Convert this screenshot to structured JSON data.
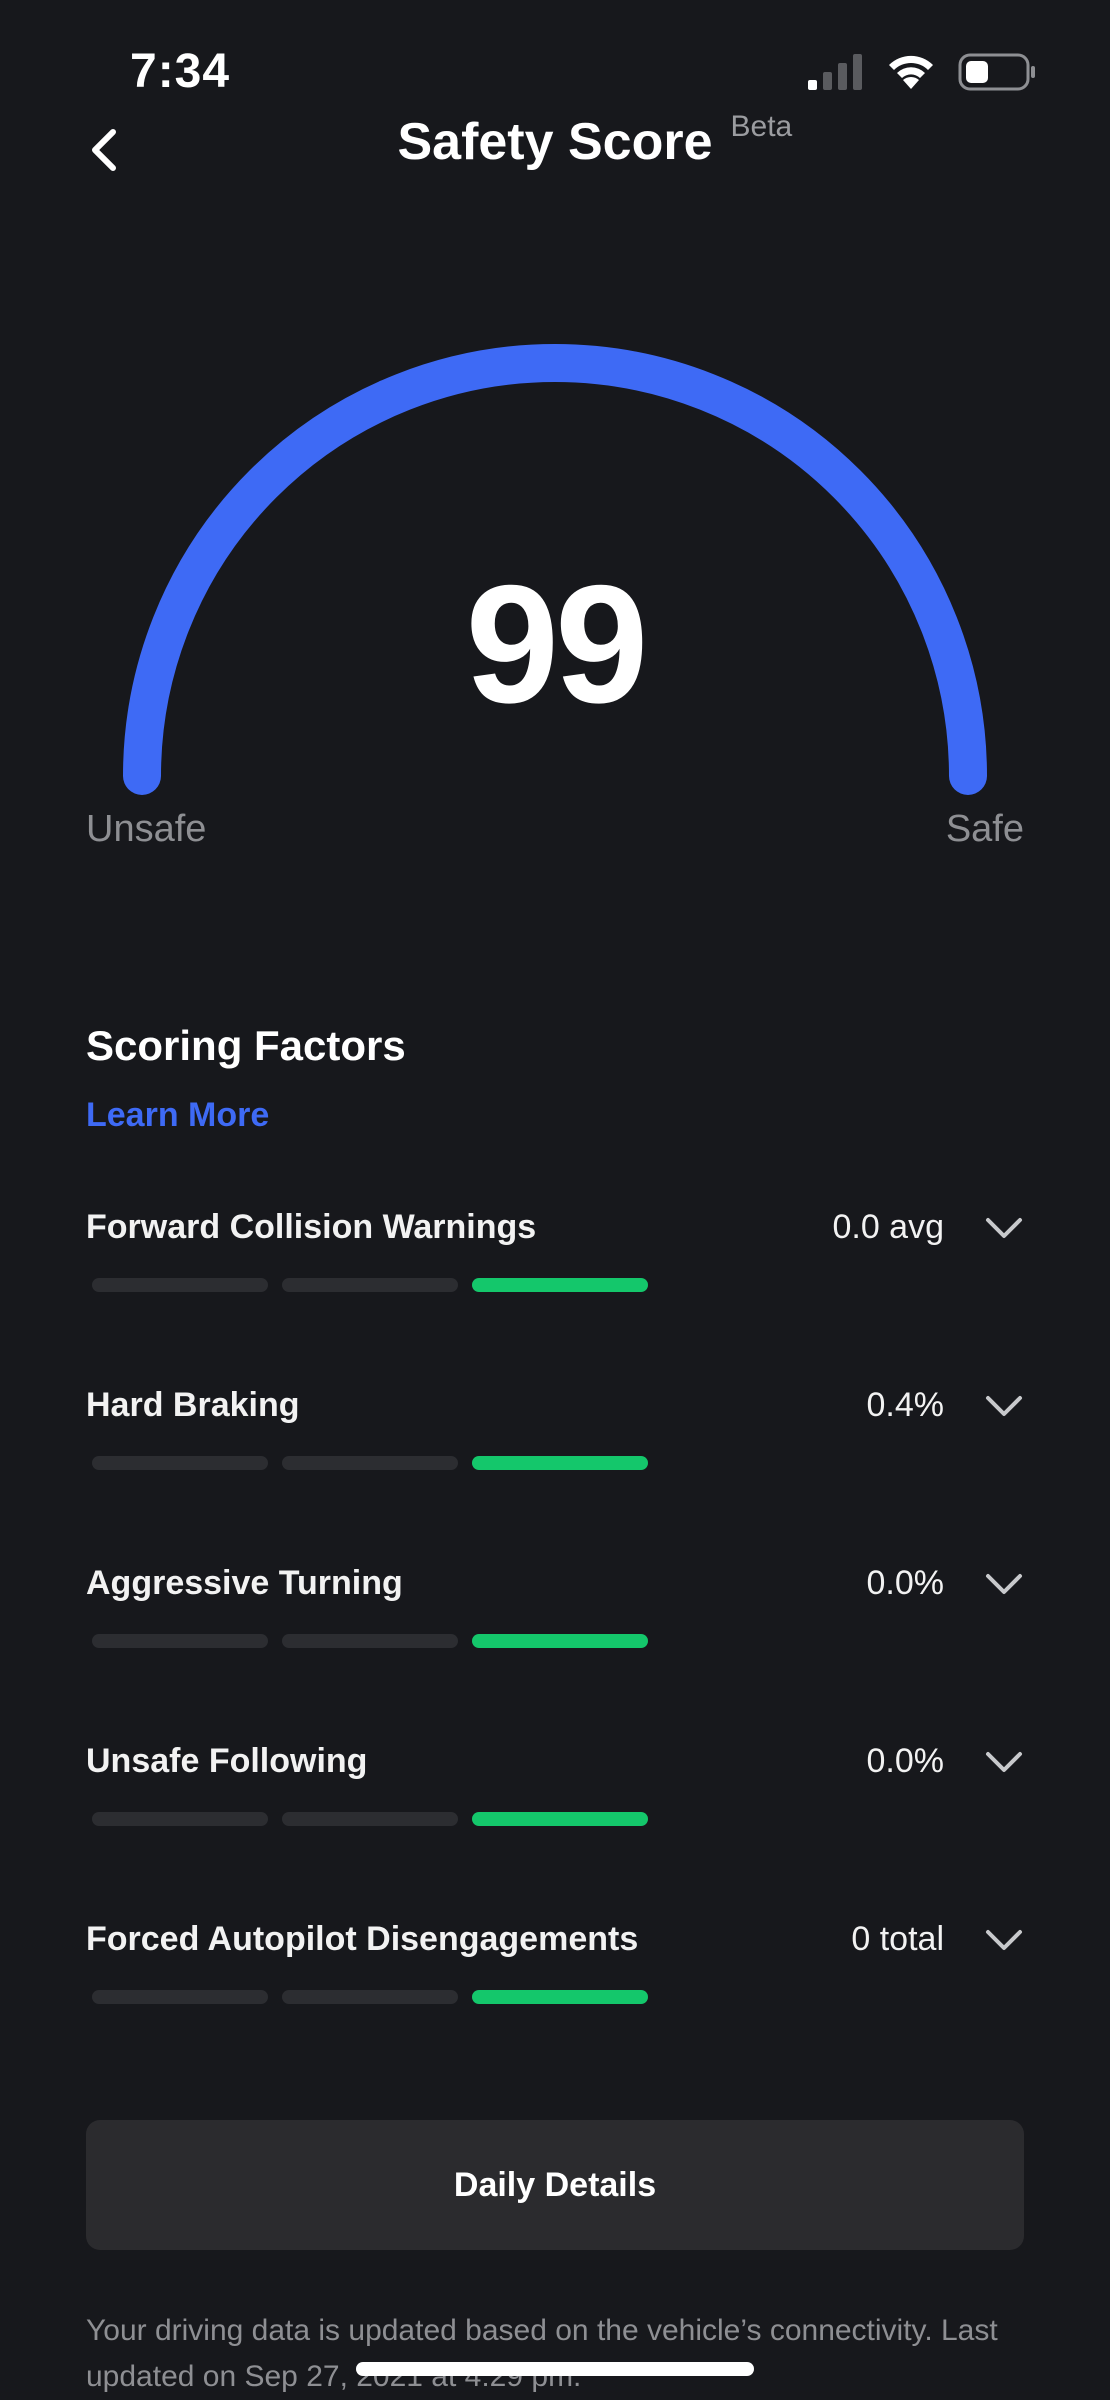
{
  "status_bar": {
    "time": "7:34",
    "icons": [
      "cellular-signal-icon",
      "wifi-icon",
      "battery-icon"
    ]
  },
  "header": {
    "title": "Safety Score",
    "badge": "Beta",
    "back_icon": "chevron-left-icon"
  },
  "gauge": {
    "score": "99",
    "score_value": 99,
    "min": 0,
    "max": 100,
    "left_label": "Unsafe",
    "right_label": "Safe",
    "color": "#3e6af5"
  },
  "scoring": {
    "title": "Scoring Factors",
    "learn_more": "Learn More",
    "active_color": "#14c76b",
    "factors": [
      {
        "name": "Forward Collision Warnings",
        "value": "0.0 avg",
        "level": 3,
        "of": 3
      },
      {
        "name": "Hard Braking",
        "value": "0.4%",
        "level": 3,
        "of": 3
      },
      {
        "name": "Aggressive Turning",
        "value": "0.0%",
        "level": 3,
        "of": 3
      },
      {
        "name": "Unsafe Following",
        "value": "0.0%",
        "level": 3,
        "of": 3
      },
      {
        "name": "Forced Autopilot Disengagements",
        "value": "0 total",
        "level": 3,
        "of": 3
      }
    ]
  },
  "daily_details": {
    "label": "Daily Details"
  },
  "footnote": "Your driving data is updated based on the vehicle’s connectivity. Last updated on Sep 27, 2021 at 4:29 pm."
}
